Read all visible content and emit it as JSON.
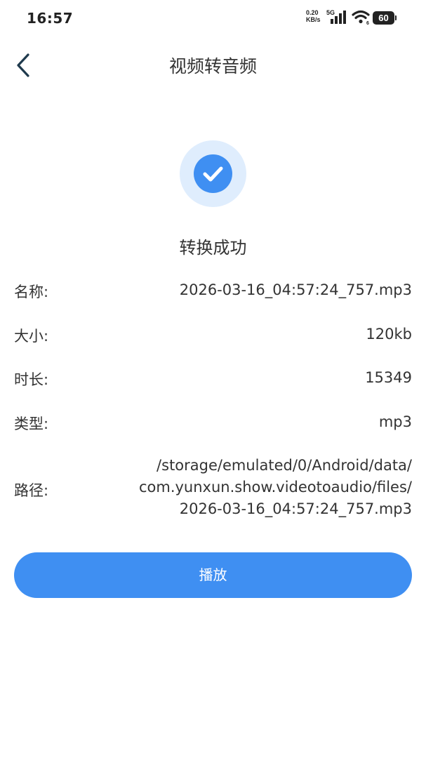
{
  "status_bar": {
    "time": "16:57",
    "net_speed_value": "0.20",
    "net_speed_unit": "KB/s",
    "network_type": "5G",
    "battery": "60"
  },
  "header": {
    "title": "视频转音频",
    "back_icon": "chevron-left-icon"
  },
  "result": {
    "icon": "check-circle-icon",
    "message": "转换成功"
  },
  "info": {
    "name_label": "名称:",
    "name_value": "2026-03-16_04:57:24_757.mp3",
    "size_label": "大小:",
    "size_value": "120kb",
    "duration_label": "时长:",
    "duration_value": "15349",
    "type_label": "类型:",
    "type_value": "mp3",
    "path_label": "路径:",
    "path_lines": [
      "/storage/emulated/0/Android/data/",
      "com.yunxun.show.videotoaudio/files/",
      "2026-03-16_04:57:24_757.mp3"
    ]
  },
  "actions": {
    "play_label": "播放"
  },
  "colors": {
    "accent": "#3f8ff2",
    "accent_light": "#dfedfd"
  }
}
